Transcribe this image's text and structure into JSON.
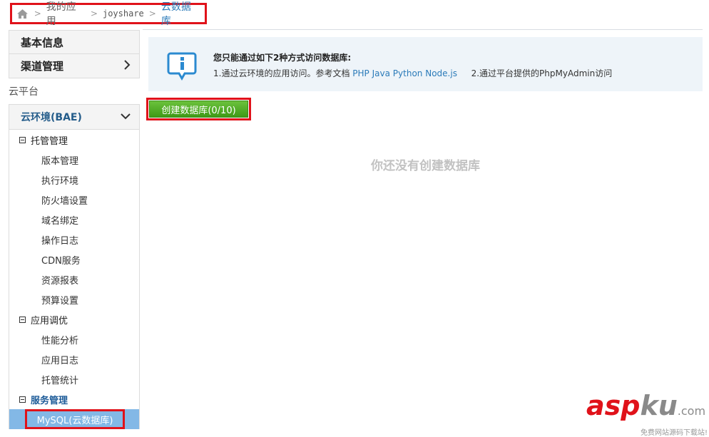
{
  "breadcrumb": {
    "items": [
      "我的应用",
      "joyshare",
      "云数据库"
    ],
    "separator": ">"
  },
  "sidebar": {
    "basic_info": "基本信息",
    "channel_mgmt": "渠道管理",
    "channel_chevron": "›",
    "section_label": "云平台",
    "cloud_env": "云环境(BAE)",
    "cloud_env_chevron": "⌄",
    "groups": [
      {
        "label": "托管管理",
        "items": [
          "版本管理",
          "执行环境",
          "防火墙设置",
          "域名绑定",
          "操作日志",
          "CDN服务",
          "资源报表",
          "预算设置"
        ]
      },
      {
        "label": "应用调优",
        "items": [
          "性能分析",
          "应用日志",
          "托管统计"
        ]
      },
      {
        "label": "服务管理",
        "items": [
          "MySQL(云数据库)"
        ]
      }
    ]
  },
  "info": {
    "title": "您只能通过如下2种方式访问数据库:",
    "line_prefix": "1.通过云环境的应用访问。参考文档",
    "links": [
      "PHP",
      "Java",
      "Python",
      "Node.js"
    ],
    "line_suffix": "2.通过平台提供的PhpMyAdmin访问"
  },
  "create_button": "创建数据库(0/10)",
  "empty_message": "你还没有创建数据库",
  "watermark": {
    "asp": "asp",
    "ku": "ku",
    "com": ".com",
    "sub": "免费网站源码下载站!"
  },
  "colors": {
    "highlight_red": "#e0121a",
    "link_blue": "#2b7bb9",
    "button_green": "#4fa823",
    "selected_bg": "#83b8e6"
  }
}
